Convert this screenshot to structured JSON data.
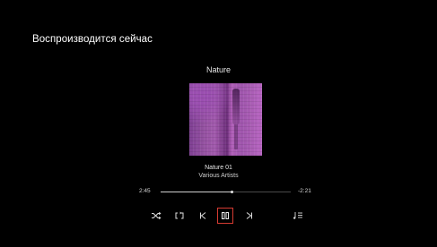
{
  "header": {
    "title": "Воспроизводится сейчас"
  },
  "now_playing": {
    "album": "Nature",
    "track": "Nature 01",
    "artist": "Various Artists",
    "time_elapsed": "2:45",
    "time_remaining": "-2:21",
    "progress": 0.55
  },
  "controls": [
    {
      "name": "shuffle-button",
      "icon": "shuffle-icon"
    },
    {
      "name": "repeat-button",
      "icon": "repeat-icon"
    },
    {
      "name": "previous-button",
      "icon": "skip-previous-icon"
    },
    {
      "name": "pause-button",
      "icon": "pause-icon",
      "focused": true
    },
    {
      "name": "next-button",
      "icon": "skip-next-icon"
    },
    {
      "name": "queue-button",
      "icon": "queue-icon"
    }
  ],
  "colors": {
    "background": "#000000",
    "text": "#ffffff",
    "focus_outline": "#d63b32",
    "album_art_primary": "#9a52aa"
  }
}
